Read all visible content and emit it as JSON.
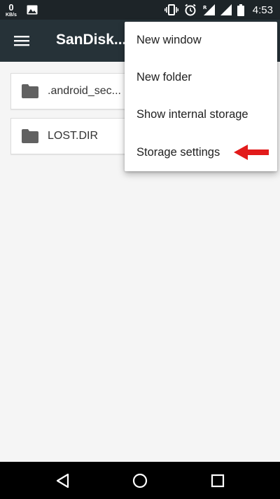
{
  "status_bar": {
    "net_speed_value": "0",
    "net_speed_unit": "KB/s",
    "time": "4:53",
    "icons": [
      "image-icon",
      "vibrate-icon",
      "alarm-icon",
      "signal-roaming-icon",
      "signal-icon",
      "battery-icon"
    ]
  },
  "toolbar": {
    "title": "SanDisk...",
    "menu_icon": "hamburger-menu-icon"
  },
  "files": [
    {
      "name": ".android_sec...",
      "icon": "folder-icon"
    },
    {
      "name": "LOST.DIR",
      "icon": "folder-icon"
    }
  ],
  "overflow_menu": {
    "items": [
      {
        "label": "New window"
      },
      {
        "label": "New folder"
      },
      {
        "label": "Show internal storage"
      },
      {
        "label": "Storage settings"
      }
    ],
    "annotation": "red-arrow-pointer"
  },
  "nav_bar": {
    "buttons": [
      "back-icon",
      "home-icon",
      "recents-icon"
    ]
  },
  "colors": {
    "status_bar_bg": "#1d2428",
    "toolbar_bg": "#263238",
    "content_bg": "#f5f5f5",
    "folder_icon": "#616161",
    "arrow_red": "#e21b1b",
    "nav_bar_bg": "#000000"
  }
}
